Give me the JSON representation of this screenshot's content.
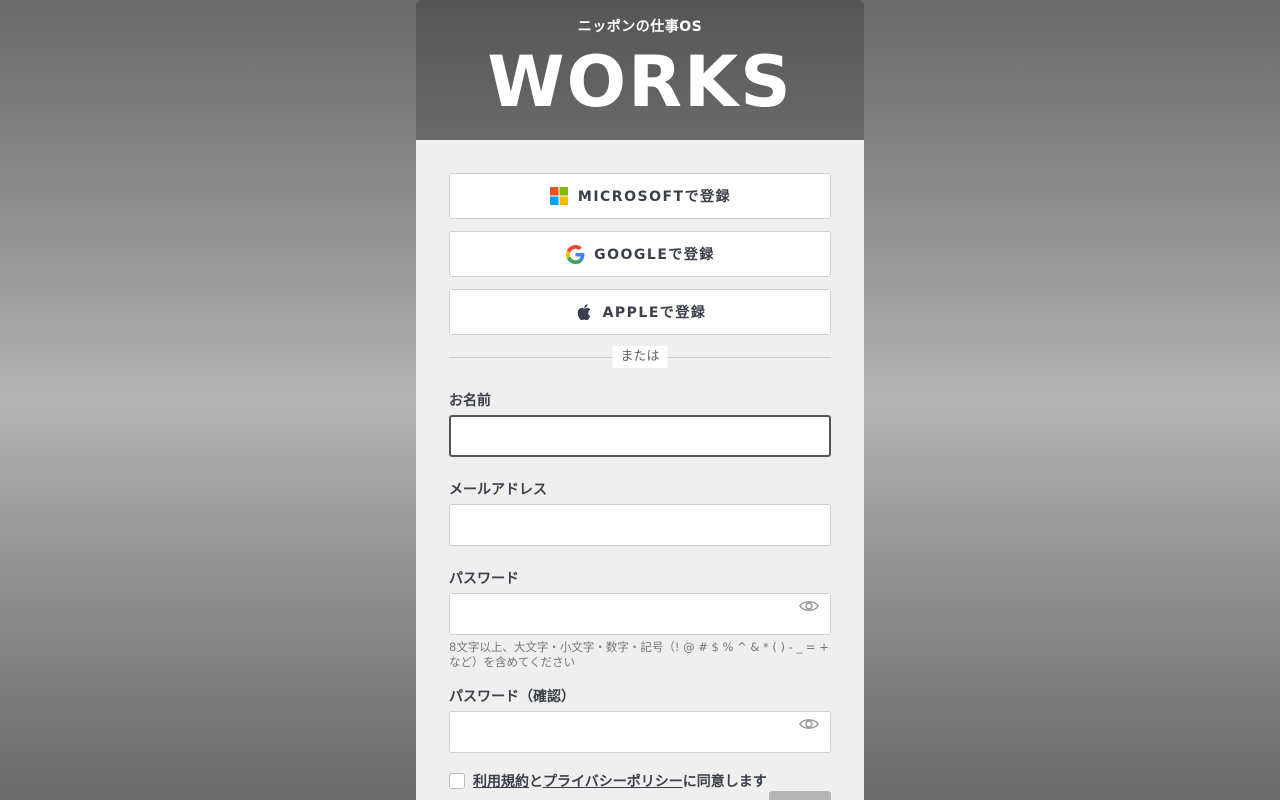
{
  "header": {
    "tagline": "ニッポンの仕事OS",
    "logo": "WORKS"
  },
  "sso": {
    "microsoft_label": "MICROSOFTで登録",
    "google_label": "GOOGLEで登録",
    "apple_label": "APPLEで登録"
  },
  "divider_label": "または",
  "form": {
    "name_label": "お名前",
    "name_value": "",
    "email_label": "メールアドレス",
    "email_value": "",
    "password_label": "パスワード",
    "password_value": "",
    "password_hint": "8文字以上、大文字・小文字・数字・記号（! @ # $ % ^ & * ( ) - _ = + など）を含めてください",
    "password_confirm_label": "パスワード（確認）",
    "password_confirm_value": ""
  },
  "agreement": {
    "terms_link": "利用規約",
    "joiner": "と",
    "privacy_link": "プライバシーポリシー",
    "suffix": "に同意します",
    "checked": false
  },
  "icons": {
    "microsoft": "microsoft-logo-icon",
    "google": "google-logo-icon",
    "apple": "apple-logo-icon",
    "eye": "eye-icon"
  },
  "colors": {
    "header_bg": "#5a5a5a",
    "card_bg": "#efefef",
    "text_primary": "#3a3f4a",
    "ms_red": "#f25022",
    "ms_green": "#7fba00",
    "ms_blue": "#00a4ef",
    "ms_yellow": "#ffb900"
  }
}
